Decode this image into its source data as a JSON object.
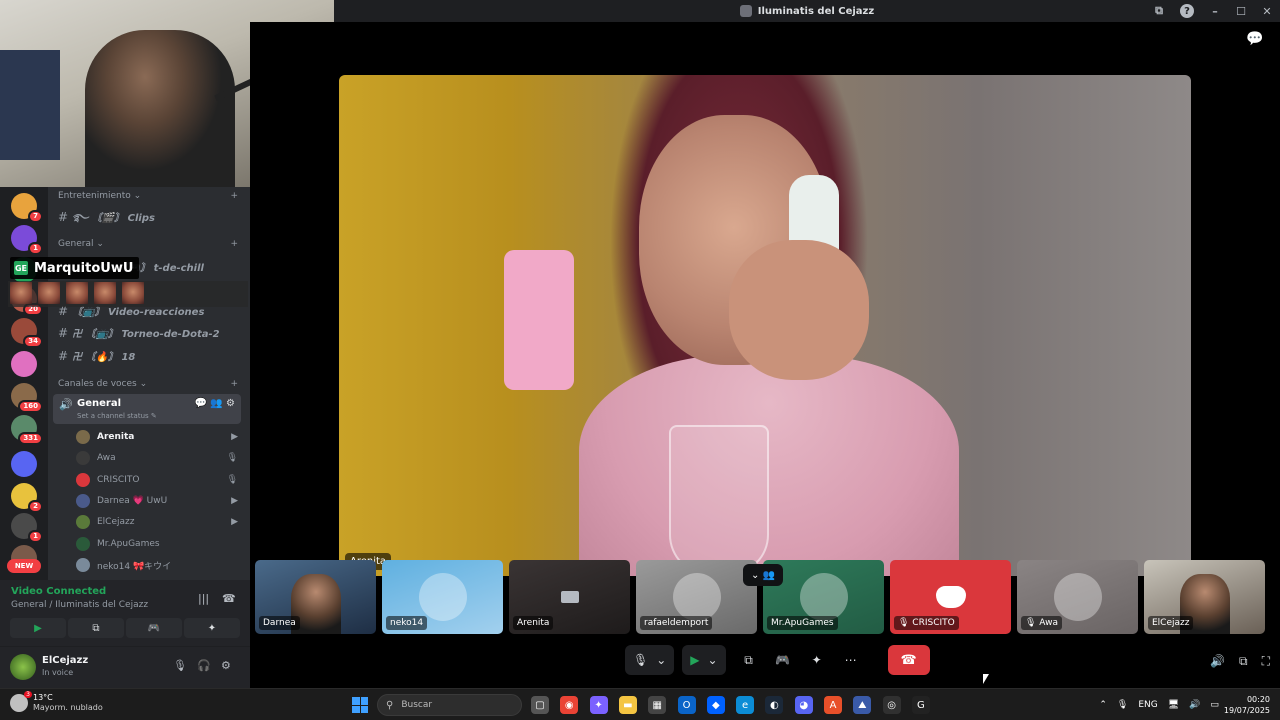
{
  "window": {
    "title": "Iluminatis del Cejazz",
    "help": "?",
    "minimize": "–",
    "maximize": "☐",
    "close": "✕",
    "screen_icon": "⧉"
  },
  "servers": [
    {
      "badge": "7",
      "color": "#e8a33d",
      "icon": "fox-icon"
    },
    {
      "badge": "1",
      "color": "#7b4bd9",
      "icon": "sword-icon"
    },
    {
      "badge": "",
      "color": "#23a55a",
      "icon": "user-avatar-icon"
    },
    {
      "badge": "20",
      "color": "#b85a4a",
      "icon": "user-avatar-icon"
    },
    {
      "badge": "34",
      "color": "#9a4a3a",
      "icon": "user-avatar-icon"
    },
    {
      "badge": "",
      "color": "#e070c0",
      "icon": "logo-icon"
    },
    {
      "badge": "160",
      "color": "#8a6a4a",
      "icon": "user-avatar-icon"
    },
    {
      "badge": "331",
      "color": "#5a8a6a",
      "icon": "user-avatar-icon"
    },
    {
      "badge": "",
      "color": "#5865f2",
      "icon": "folder-icon"
    },
    {
      "badge": "2",
      "color": "#e8c23d",
      "icon": "crown-icon"
    },
    {
      "badge": "1",
      "color": "#4a4a4a",
      "icon": "user-avatar-icon"
    },
    {
      "badge": "",
      "color": "#7a5a4a",
      "icon": "user-avatar-icon"
    }
  ],
  "new_badge": "NEW",
  "channel_list": {
    "category_1": "Entretenimiento",
    "category_1_chevron": "⌄",
    "channels_1": [
      {
        "label": "࿐ 〘🎬〙 Clips"
      }
    ],
    "category_2": "General",
    "category_2_chevron": "⌄",
    "channels_2": [
      {
        "label": "࿐ 〘🎮〙 t-de-chill"
      },
      {
        "label": "〘📺〙 Video-reacciones"
      },
      {
        "label": "卍 〘📺〙 Torneo-de-Dota-2"
      },
      {
        "label": "卍 〘🔥〙 18"
      }
    ],
    "category_3": "Canales de voces",
    "category_3_chevron": "⌄",
    "add": "+",
    "hash": "#",
    "voice_channel": {
      "name": "General",
      "status": "Set a channel status ✎",
      "icon": "🔊",
      "tools": "💬 👥 ⚙",
      "users": [
        {
          "name": "Arenita",
          "bold": true,
          "color": "#7a6a4a",
          "right": "▶"
        },
        {
          "name": "Awa",
          "bold": false,
          "color": "#3a3a3a",
          "right": "🎙"
        },
        {
          "name": "CRISCITO",
          "bold": false,
          "color": "#da373c",
          "right": "🎙"
        },
        {
          "name": "Darnea 💗 UwU",
          "bold": false,
          "color": "#4a5a8a",
          "right": "▶"
        },
        {
          "name": "ElCejazz",
          "bold": false,
          "color": "#5a7a3a",
          "right": "▶"
        },
        {
          "name": "Mr.ApuGames",
          "bold": false,
          "color": "#2a5a3a",
          "right": ""
        },
        {
          "name": "neko14 🎀キウイ",
          "bold": false,
          "color": "#7a8a9a",
          "right": ""
        }
      ]
    }
  },
  "overlay": {
    "speaker": "MarquitoUwU",
    "game_icon": "GE"
  },
  "voice_panel": {
    "title": "Video Connected",
    "subtitle": "General / Iluminatis del Cejazz",
    "signal": "|||",
    "disconnect": "☎",
    "buttons": {
      "camera": "▶",
      "screen": "⧉",
      "activity": "🎮",
      "soundboard": "✦"
    }
  },
  "user_panel": {
    "name": "ElCejazz",
    "status": "In voice",
    "mic": "🎙",
    "headphones": "🎧",
    "settings": "⚙"
  },
  "stage": {
    "main_name": "Arenita",
    "chat": "💬",
    "tiles": [
      {
        "name": "Darnea",
        "kind": "video",
        "bg": "linear-gradient(160deg,#4a6a8a,#1e2e44)"
      },
      {
        "name": "neko14",
        "kind": "avatar",
        "bg": "linear-gradient(160deg,#5fb0e0,#a2d0ee)"
      },
      {
        "name": "Arenita",
        "kind": "camera-off",
        "bg": "linear-gradient(160deg,#3a3434,#1e1b1b)"
      },
      {
        "name": "rafaeldemport",
        "kind": "avatar",
        "bg": "linear-gradient(160deg,#9a9a9a,#6a6a6a)"
      },
      {
        "name": "Mr.ApuGames",
        "kind": "avatar",
        "bg": "linear-gradient(160deg,#2e7a5a,#225c44)"
      },
      {
        "name": "🎙 CRISCITO",
        "kind": "discord",
        "bg": "#da373c"
      },
      {
        "name": "🎙 Awa",
        "kind": "avatar",
        "bg": "linear-gradient(160deg,#8a8484,#6a6464)"
      },
      {
        "name": "ElCejazz",
        "kind": "video",
        "bg": "linear-gradient(160deg,#c8c4ba,#6a6056)"
      }
    ],
    "tile_overhead": "⌄ 👥",
    "controls": {
      "mic": "🎙",
      "mic_caret": "⌄",
      "video": "▶",
      "video_caret": "⌄",
      "screen": "⧉",
      "activity": "🎮",
      "soundboard": "✦",
      "more": "⋯",
      "leave": "☎"
    },
    "right_controls": {
      "volume": "🔊",
      "popout": "⧉",
      "fullscreen": "⛶"
    }
  },
  "taskbar": {
    "weather_temp": "13°C",
    "weather_desc": "Mayorm. nublado",
    "weather_badge": "3",
    "search_placeholder": "Buscar",
    "search_icon": "⚲",
    "apps": [
      {
        "icon": "task-view-icon",
        "glyph": "▢",
        "color": "#555"
      },
      {
        "icon": "chrome-icon",
        "glyph": "◉",
        "color": "#ea4335"
      },
      {
        "icon": "copilot-icon",
        "glyph": "✦",
        "color": "#7b61ff"
      },
      {
        "icon": "file-explorer-icon",
        "glyph": "▬",
        "color": "#f4c542"
      },
      {
        "icon": "store-icon",
        "glyph": "▦",
        "color": "#444"
      },
      {
        "icon": "outlook-icon",
        "glyph": "O",
        "color": "#0a64c8"
      },
      {
        "icon": "dropbox-icon",
        "glyph": "◆",
        "color": "#0061fe"
      },
      {
        "icon": "edge-icon",
        "glyph": "e",
        "color": "#0c8dd6"
      },
      {
        "icon": "steam-icon",
        "glyph": "◐",
        "color": "#1b2838"
      },
      {
        "icon": "discord-icon",
        "glyph": "◕",
        "color": "#5865f2"
      },
      {
        "icon": "app-icon",
        "glyph": "A",
        "color": "#e8502a"
      },
      {
        "icon": "app-icon",
        "glyph": "⛰",
        "color": "#3a5aa8"
      },
      {
        "icon": "obs-icon",
        "glyph": "◎",
        "color": "#303030"
      },
      {
        "icon": "app-icon",
        "glyph": "G",
        "color": "#222"
      }
    ],
    "tray": {
      "chevron": "⌃",
      "mic": "🎙",
      "lang": "ENG",
      "network": "🖥",
      "volume": "🔊",
      "battery": "▭"
    },
    "time": "00:20",
    "date": "19/07/2025"
  }
}
